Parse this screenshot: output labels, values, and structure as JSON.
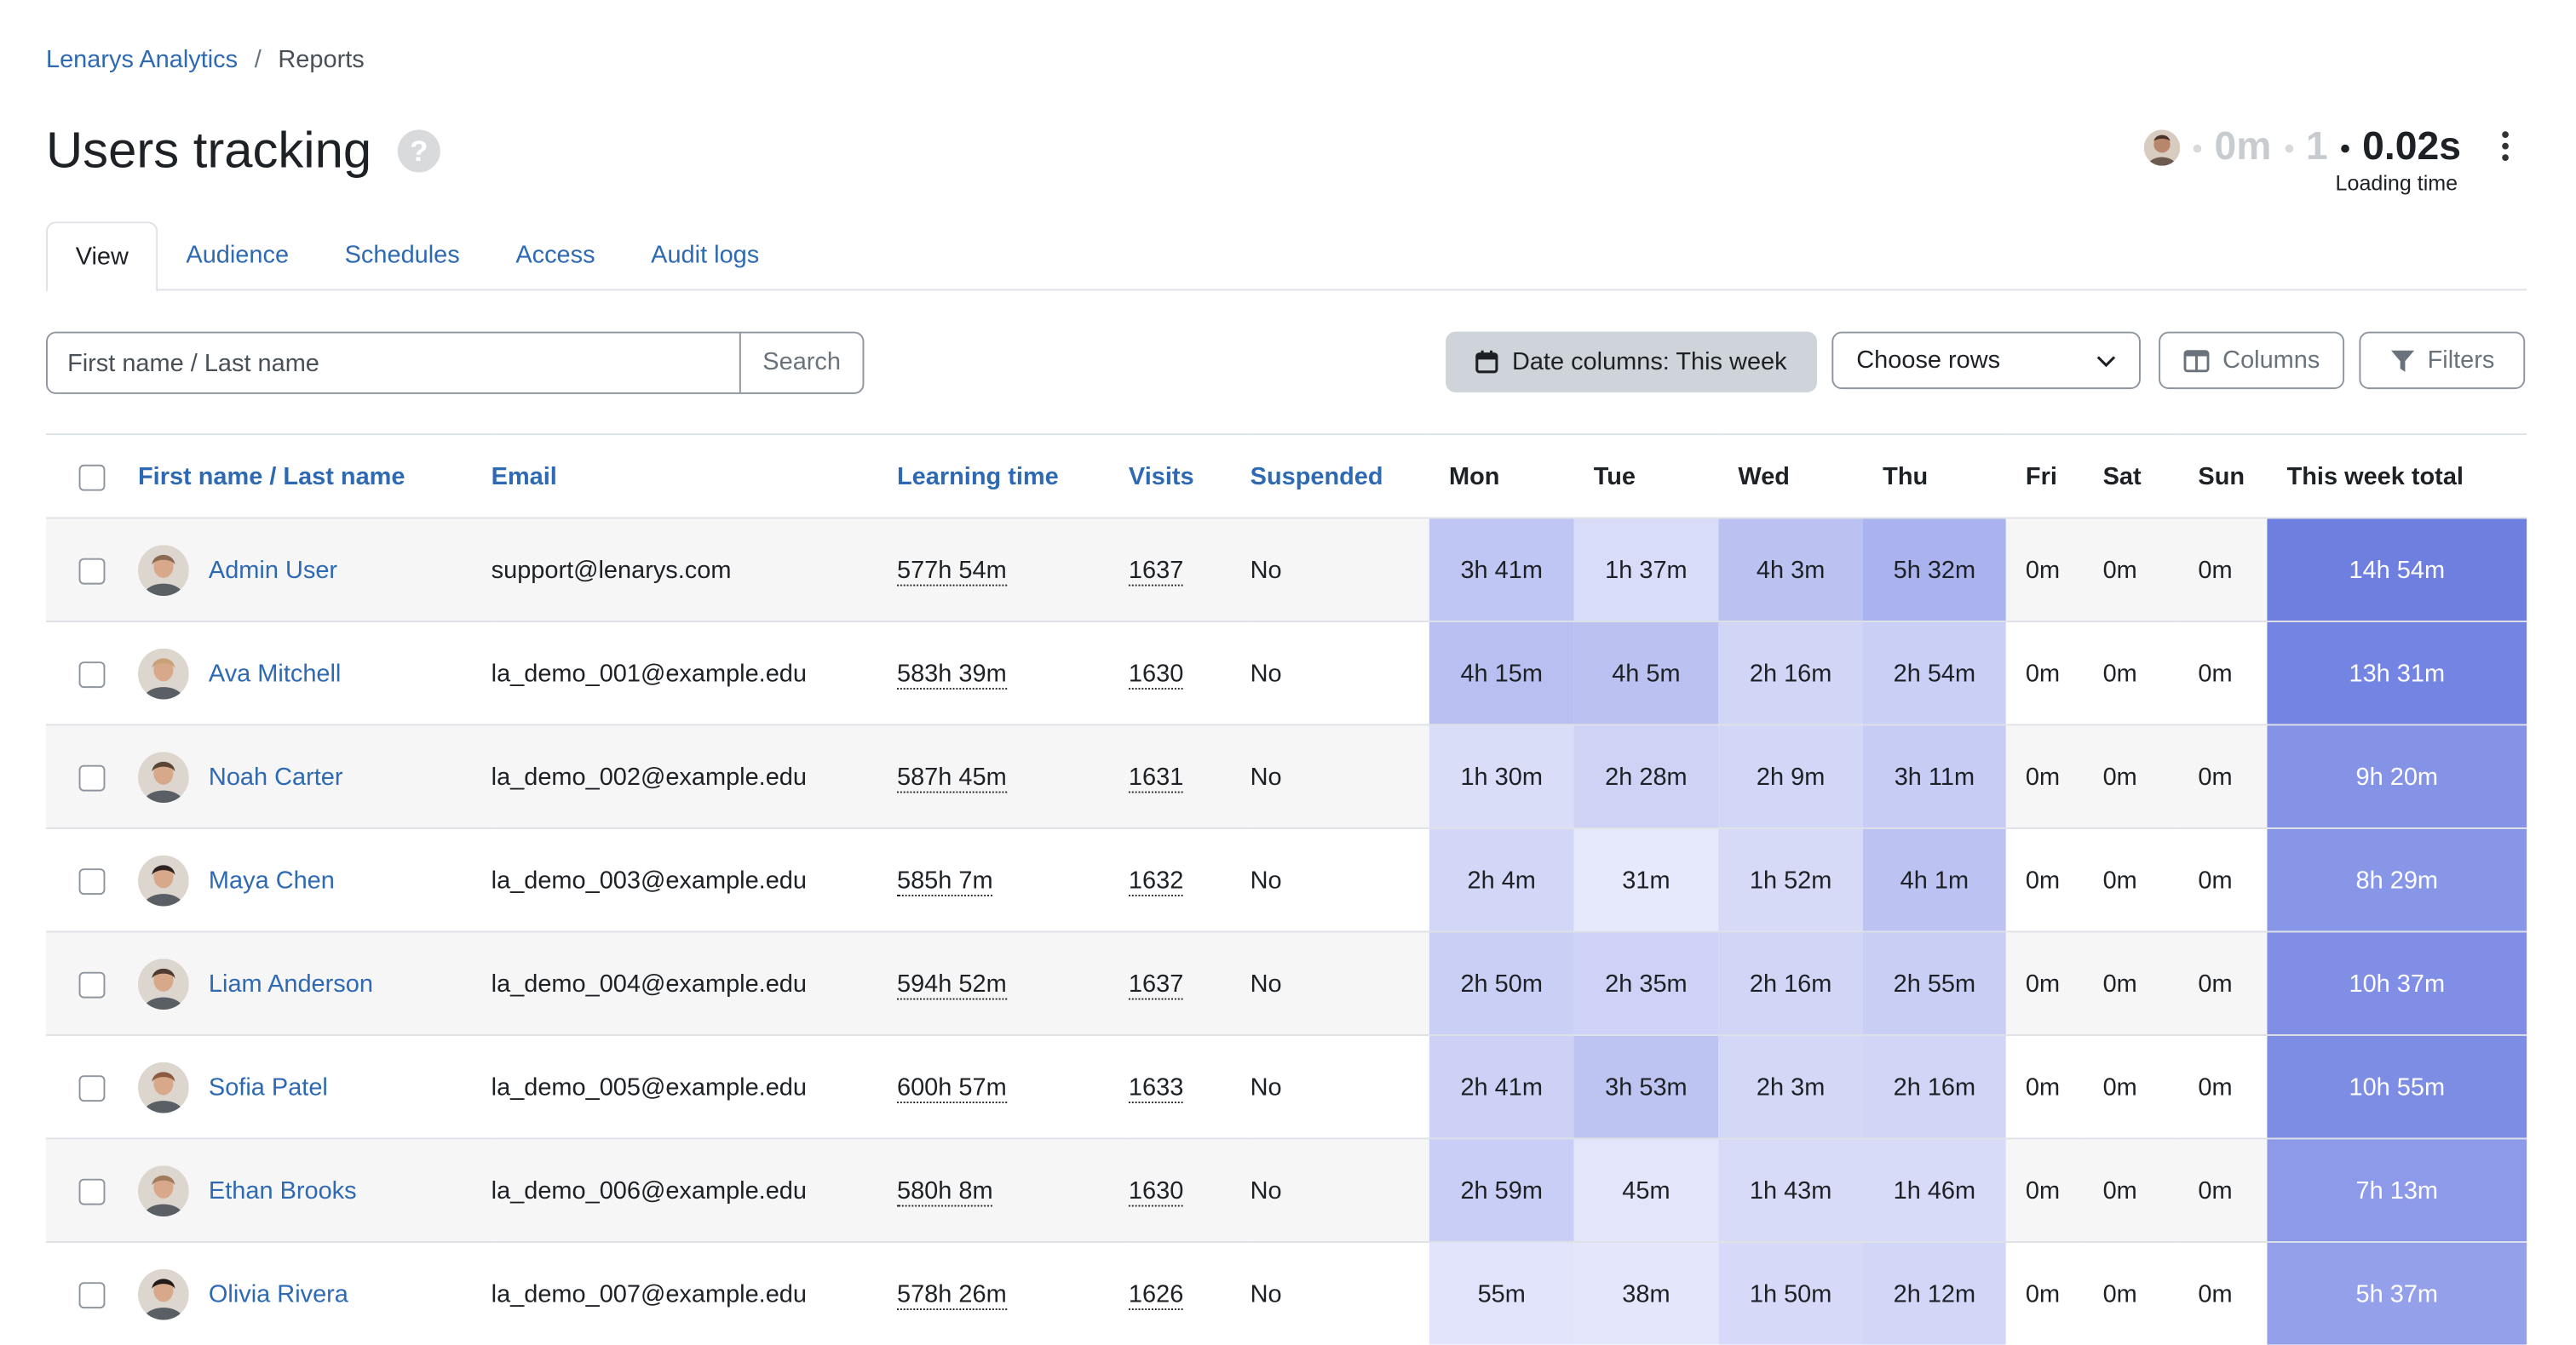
{
  "breadcrumb": {
    "root": "Lenarys Analytics",
    "separator": "/",
    "current": "Reports"
  },
  "page": {
    "title": "Users tracking",
    "help": "?"
  },
  "stats": {
    "time": "0m",
    "count": "1",
    "loading_value": "0.02s",
    "loading_label": "Loading time"
  },
  "tabs": [
    {
      "label": "View",
      "active": true
    },
    {
      "label": "Audience"
    },
    {
      "label": "Schedules"
    },
    {
      "label": "Access"
    },
    {
      "label": "Audit logs"
    }
  ],
  "search": {
    "placeholder": "First name / Last name",
    "button": "Search"
  },
  "toolbar": {
    "date_columns": "Date columns: This week",
    "rows_select": "Choose rows",
    "columns": "Columns",
    "filters": "Filters"
  },
  "colors": {
    "link": "#2e69b3",
    "heat_low": "#e6e8fb",
    "heat_high": "#aab3ee",
    "total": "#6e7fe0"
  },
  "table": {
    "headers": {
      "name": "First name / Last name",
      "email": "Email",
      "learning": "Learning time",
      "visits": "Visits",
      "suspended": "Suspended",
      "mon": "Mon",
      "tue": "Tue",
      "wed": "Wed",
      "thu": "Thu",
      "fri": "Fri",
      "sat": "Sat",
      "sun": "Sun",
      "total": "This week total"
    },
    "rows": [
      {
        "name": "Admin User",
        "email": "support@lenarys.com",
        "learning": "577h 54m",
        "visits": "1637",
        "suspended": "No",
        "days": [
          "3h 41m",
          "1h 37m",
          "4h 3m",
          "5h 32m",
          "0m",
          "0m",
          "0m"
        ],
        "minutes": [
          221,
          97,
          243,
          332
        ],
        "total": "14h 54m",
        "total_min": 894,
        "avatar": "#8a6a52"
      },
      {
        "name": "Ava Mitchell",
        "email": "la_demo_001@example.edu",
        "learning": "583h 39m",
        "visits": "1630",
        "suspended": "No",
        "days": [
          "4h 15m",
          "4h 5m",
          "2h 16m",
          "2h 54m",
          "0m",
          "0m",
          "0m"
        ],
        "minutes": [
          255,
          245,
          136,
          174
        ],
        "total": "13h 31m",
        "total_min": 811,
        "avatar": "#c9a27a"
      },
      {
        "name": "Noah Carter",
        "email": "la_demo_002@example.edu",
        "learning": "587h 45m",
        "visits": "1631",
        "suspended": "No",
        "days": [
          "1h 30m",
          "2h 28m",
          "2h 9m",
          "3h 11m",
          "0m",
          "0m",
          "0m"
        ],
        "minutes": [
          90,
          148,
          129,
          191
        ],
        "total": "9h 20m",
        "total_min": 560,
        "avatar": "#5b4636"
      },
      {
        "name": "Maya Chen",
        "email": "la_demo_003@example.edu",
        "learning": "585h 7m",
        "visits": "1632",
        "suspended": "No",
        "days": [
          "2h 4m",
          "31m",
          "1h 52m",
          "4h 1m",
          "0m",
          "0m",
          "0m"
        ],
        "minutes": [
          124,
          31,
          112,
          241
        ],
        "total": "8h 29m",
        "total_min": 509,
        "avatar": "#2e241f"
      },
      {
        "name": "Liam Anderson",
        "email": "la_demo_004@example.edu",
        "learning": "594h 52m",
        "visits": "1637",
        "suspended": "No",
        "days": [
          "2h 50m",
          "2h 35m",
          "2h 16m",
          "2h 55m",
          "0m",
          "0m",
          "0m"
        ],
        "minutes": [
          170,
          155,
          136,
          175
        ],
        "total": "10h 37m",
        "total_min": 637,
        "avatar": "#4d3b30"
      },
      {
        "name": "Sofia Patel",
        "email": "la_demo_005@example.edu",
        "learning": "600h 57m",
        "visits": "1633",
        "suspended": "No",
        "days": [
          "2h 41m",
          "3h 53m",
          "2h 3m",
          "2h 16m",
          "0m",
          "0m",
          "0m"
        ],
        "minutes": [
          161,
          233,
          123,
          136
        ],
        "total": "10h 55m",
        "total_min": 655,
        "avatar": "#8c5a40"
      },
      {
        "name": "Ethan Brooks",
        "email": "la_demo_006@example.edu",
        "learning": "580h 8m",
        "visits": "1630",
        "suspended": "No",
        "days": [
          "2h 59m",
          "45m",
          "1h 43m",
          "1h 46m",
          "0m",
          "0m",
          "0m"
        ],
        "minutes": [
          179,
          45,
          103,
          106
        ],
        "total": "7h 13m",
        "total_min": 433,
        "avatar": "#a07a5c"
      },
      {
        "name": "Olivia Rivera",
        "email": "la_demo_007@example.edu",
        "learning": "578h 26m",
        "visits": "1626",
        "suspended": "No",
        "days": [
          "55m",
          "38m",
          "1h 50m",
          "2h 12m",
          "0m",
          "0m",
          "0m"
        ],
        "minutes": [
          55,
          38,
          110,
          132
        ],
        "total": "5h 37m",
        "total_min": 337,
        "avatar": "#231b17"
      }
    ]
  }
}
